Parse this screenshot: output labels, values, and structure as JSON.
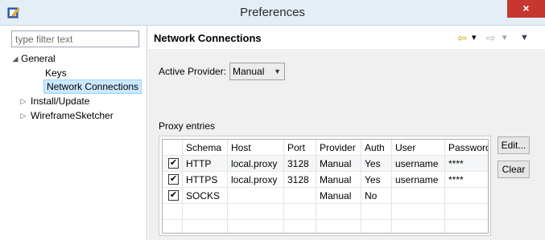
{
  "window": {
    "title": "Preferences",
    "close_glyph": "×",
    "app_icon": "edit-icon"
  },
  "sidebar": {
    "filter_placeholder": "type filter text",
    "items": [
      {
        "label": "General",
        "toggle": "◢",
        "expanded": true,
        "selected": false
      },
      {
        "label": "Keys",
        "toggle": "",
        "expanded": false,
        "selected": false
      },
      {
        "label": "Network Connections",
        "toggle": "",
        "expanded": false,
        "selected": true
      },
      {
        "label": "Install/Update",
        "toggle": "▷",
        "expanded": false,
        "selected": false
      },
      {
        "label": "WireframeSketcher",
        "toggle": "▷",
        "expanded": false,
        "selected": false
      }
    ]
  },
  "page": {
    "title": "Network Connections",
    "nav": {
      "back_icon": "⇦",
      "forward_icon": "⇨",
      "dropdown_icon": "▾",
      "menu_icon": "▼"
    },
    "active_provider_label": "Active Provider:",
    "active_provider_value": "Manual",
    "select_arrow": "▼",
    "proxy_entries_label": "Proxy entries",
    "table": {
      "columns": [
        "Schema",
        "Host",
        "Port",
        "Provider",
        "Auth",
        "User",
        "Password"
      ],
      "rows": [
        {
          "checked": true,
          "cells": [
            "HTTP",
            "local.proxy",
            "3128",
            "Manual",
            "Yes",
            "username",
            "****"
          ]
        },
        {
          "checked": true,
          "cells": [
            "HTTPS",
            "local.proxy",
            "3128",
            "Manual",
            "Yes",
            "username",
            "****"
          ]
        },
        {
          "checked": true,
          "cells": [
            "SOCKS",
            "",
            "",
            "Manual",
            "No",
            "",
            ""
          ]
        }
      ],
      "check_glyph": "✔"
    },
    "buttons": {
      "edit": "Edit...",
      "clear": "Clear"
    }
  },
  "colors": {
    "titlebar": "#e4eef7",
    "close": "#c7372f",
    "selection": "#cce8ff",
    "content_bg": "#f0f0f0"
  }
}
